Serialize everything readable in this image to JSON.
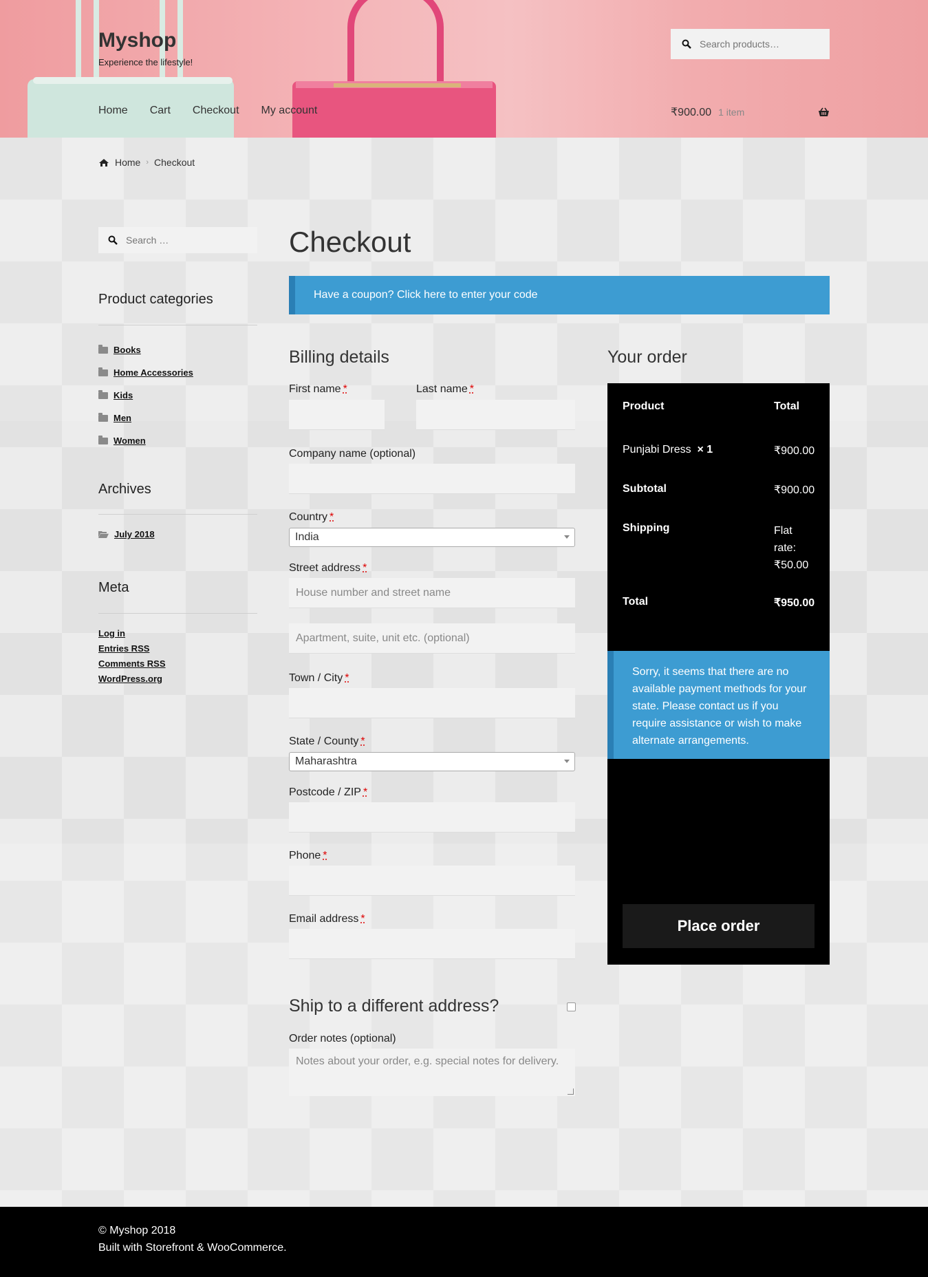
{
  "header": {
    "site_title": "Myshop",
    "tagline": "Experience the lifestyle!",
    "search_placeholder": "Search products…",
    "nav": [
      "Home",
      "Cart",
      "Checkout",
      "My account"
    ],
    "cart_amount": "₹900.00",
    "cart_count": "1 item"
  },
  "breadcrumb": {
    "home": "Home",
    "current": "Checkout"
  },
  "sidebar": {
    "search_placeholder": "Search …",
    "categories_title": "Product categories",
    "categories": [
      "Books",
      "Home Accessories",
      "Kids",
      "Men",
      "Women"
    ],
    "archives_title": "Archives",
    "archives": [
      "July 2018"
    ],
    "meta_title": "Meta",
    "meta_links": [
      "Log in",
      "Entries RSS",
      "Comments RSS",
      "WordPress.org"
    ]
  },
  "main": {
    "page_title": "Checkout",
    "coupon_text": "Have a coupon? Click here to enter your code",
    "billing_title": "Billing details",
    "labels": {
      "first_name": "First name",
      "last_name": "Last name",
      "company": "Company name (optional)",
      "country": "Country",
      "street": "Street address",
      "town": "Town / City",
      "state": "State / County",
      "postcode": "Postcode / ZIP",
      "phone": "Phone",
      "email": "Email address",
      "order_notes": "Order notes (optional)"
    },
    "required_mark": "*",
    "country_value": "India",
    "state_value": "Maharashtra",
    "street_placeholder": "House number and street name",
    "street2_placeholder": "Apartment, suite, unit etc. (optional)",
    "notes_placeholder": "Notes about your order, e.g. special notes for delivery.",
    "ship_title": "Ship to a different address?"
  },
  "order": {
    "title": "Your order",
    "col_product": "Product",
    "col_total": "Total",
    "item_name": "Punjabi Dress",
    "item_qty": "× 1",
    "item_total": "₹900.00",
    "subtotal_label": "Subtotal",
    "subtotal_value": "₹900.00",
    "shipping_label": "Shipping",
    "shipping_value_l1": "Flat",
    "shipping_value_l2": "rate:",
    "shipping_value_l3": "₹50.00",
    "total_label": "Total",
    "total_value": "₹950.00",
    "payment_notice": "Sorry, it seems that there are no available payment methods for your state. Please contact us if you require assistance or wish to make alternate arrangements.",
    "place_order": "Place order"
  },
  "footer": {
    "copyright": "© Myshop 2018",
    "built_with": "Built with Storefront & WooCommerce."
  },
  "colors": {
    "notice_blue": "#3d9cd2",
    "order_bg": "#000000",
    "button_bg": "#1a1a1a"
  }
}
